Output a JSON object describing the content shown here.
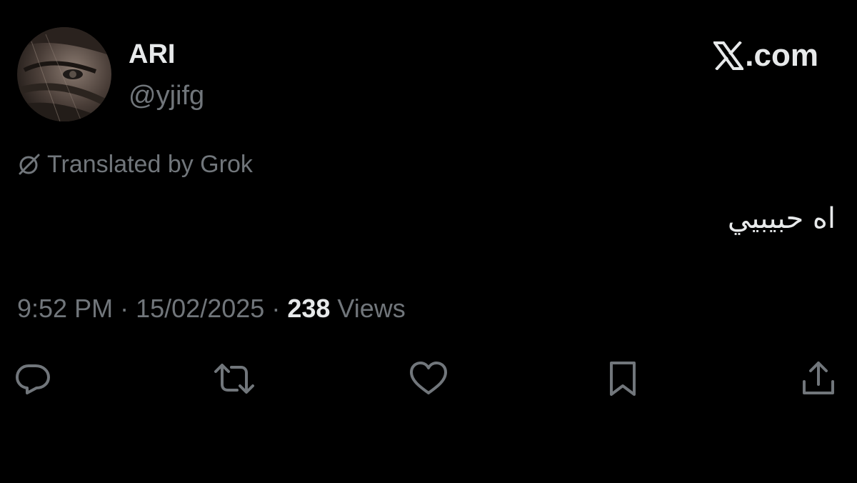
{
  "author": {
    "display_name": "ARI",
    "handle": "@yjifg",
    "avatar": "avatar-photo"
  },
  "brand": {
    "icon": "x-logo-icon",
    "label": ".com"
  },
  "translation": {
    "icon": "grok-icon",
    "label": "Translated by Grok"
  },
  "tweet": {
    "text": "اه حبيبيي"
  },
  "meta": {
    "time": "9:52 PM",
    "separator": "·",
    "date": "15/02/2025",
    "views_count": "238",
    "views_label": "Views"
  },
  "actions": [
    {
      "name": "reply",
      "icon": "reply-icon"
    },
    {
      "name": "repost",
      "icon": "repost-icon"
    },
    {
      "name": "like",
      "icon": "heart-icon"
    },
    {
      "name": "bookmark",
      "icon": "bookmark-icon"
    },
    {
      "name": "share",
      "icon": "share-icon"
    }
  ],
  "colors": {
    "background": "#000000",
    "primary_text": "#e7e9ea",
    "secondary_text": "#71767b"
  }
}
